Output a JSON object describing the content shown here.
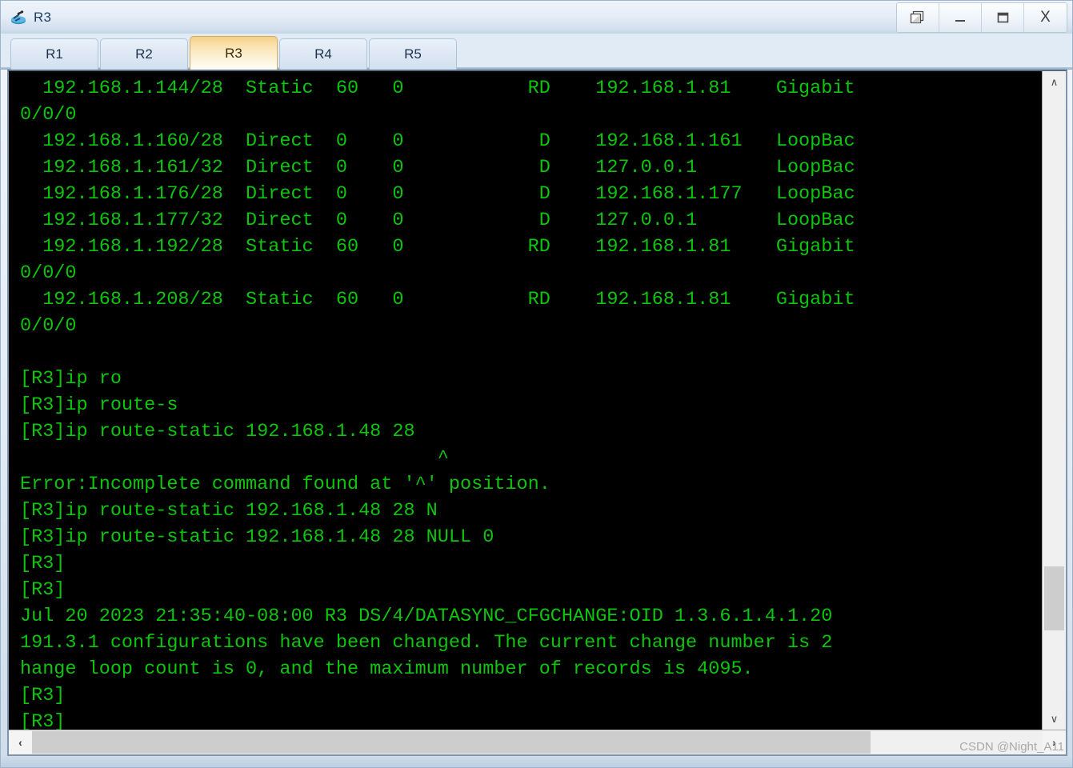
{
  "window": {
    "title": "R3",
    "icon": "router-icon",
    "buttons": [
      {
        "name": "restore-windows-button",
        "icon": "cascade-windows-icon",
        "label": ""
      },
      {
        "name": "minimize-button",
        "icon": "minimize-icon",
        "label": ""
      },
      {
        "name": "maximize-button",
        "icon": "maximize-icon",
        "label": ""
      },
      {
        "name": "close-button",
        "icon": "close-icon",
        "label": "X"
      }
    ]
  },
  "tabs": [
    {
      "label": "R1",
      "active": false
    },
    {
      "label": "R2",
      "active": false
    },
    {
      "label": "R3",
      "active": true
    },
    {
      "label": "R4",
      "active": false
    },
    {
      "label": "R5",
      "active": false
    }
  ],
  "terminal": {
    "foreground": "#0ec50e",
    "background": "#000000",
    "lines": [
      "  192.168.1.144/28  Static  60   0           RD    192.168.1.81    Gigabit",
      "0/0/0",
      "  192.168.1.160/28  Direct  0    0            D    192.168.1.161   LoopBac",
      "  192.168.1.161/32  Direct  0    0            D    127.0.0.1       LoopBac",
      "  192.168.1.176/28  Direct  0    0            D    192.168.1.177   LoopBac",
      "  192.168.1.177/32  Direct  0    0            D    127.0.0.1       LoopBac",
      "  192.168.1.192/28  Static  60   0           RD    192.168.1.81    Gigabit",
      "0/0/0",
      "  192.168.1.208/28  Static  60   0           RD    192.168.1.81    Gigabit",
      "0/0/0",
      "",
      "[R3]ip ro",
      "[R3]ip route-s",
      "[R3]ip route-static 192.168.1.48 28",
      "                                     ^",
      "Error:Incomplete command found at '^' position.",
      "[R3]ip route-static 192.168.1.48 28 N",
      "[R3]ip route-static 192.168.1.48 28 NULL 0",
      "[R3]",
      "[R3]",
      "Jul 20 2023 21:35:40-08:00 R3 DS/4/DATASYNC_CFGCHANGE:OID 1.3.6.1.4.1.20",
      "191.3.1 configurations have been changed. The current change number is 2",
      "hange loop count is 0, and the maximum number of records is 4095.",
      "[R3]",
      "[R3]"
    ]
  },
  "scrollbars": {
    "vertical": {
      "up_arrow": "∧",
      "down_arrow": "∨"
    },
    "horizontal": {
      "left_arrow": "‹",
      "right_arrow": "›"
    }
  },
  "watermark": "CSDN @Night_A11"
}
